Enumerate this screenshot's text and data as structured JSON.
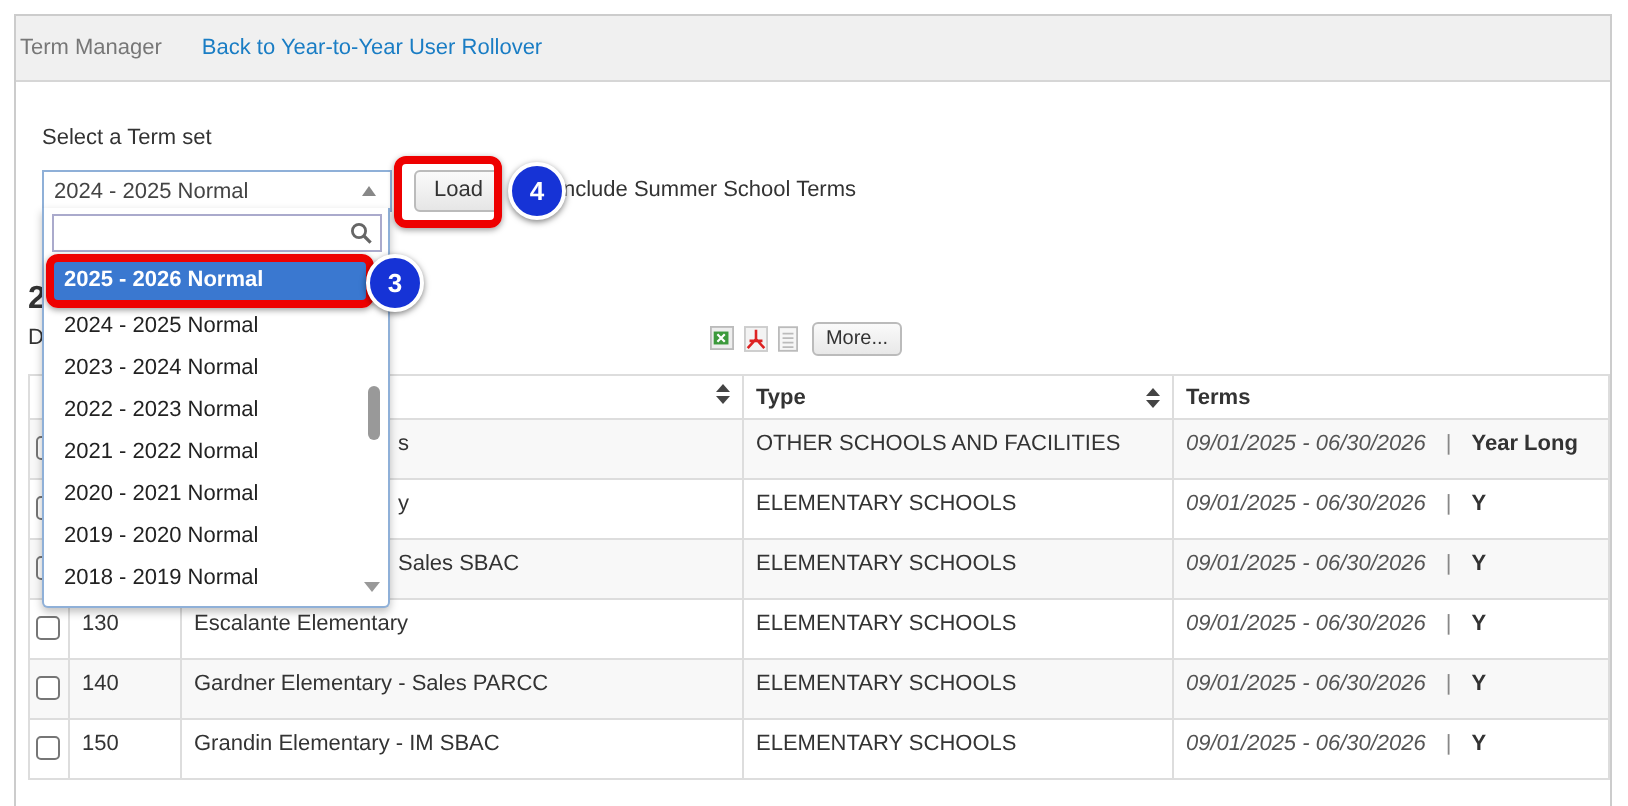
{
  "header": {
    "title": "Term Manager",
    "link": "Back to Year-to-Year User Rollover"
  },
  "term_set": {
    "label": "Select a Term set",
    "value": "2024 - 2025 Normal",
    "load_button": "Load",
    "summer_label": "nclude Summer School Terms"
  },
  "dropdown": {
    "options": [
      {
        "label": "2025 - 2026 Normal",
        "selected": true
      },
      {
        "label": "2024 - 2025 Normal",
        "selected": false
      },
      {
        "label": "2023 - 2024 Normal",
        "selected": false
      },
      {
        "label": "2022 - 2023 Normal",
        "selected": false
      },
      {
        "label": "2021 - 2022 Normal",
        "selected": false
      },
      {
        "label": "2020 - 2021 Normal",
        "selected": false
      },
      {
        "label": "2019 - 2020 Normal",
        "selected": false
      },
      {
        "label": "2018 - 2019 Normal",
        "selected": false
      }
    ]
  },
  "load_callout": "4",
  "option_callout": "3",
  "heading": "2",
  "subtitle": "D",
  "more_button": "More...",
  "table": {
    "columns": [
      "Type",
      "Terms"
    ],
    "rows": [
      {
        "checked": false,
        "covered": true,
        "number": "",
        "name": "s",
        "type": "OTHER SCHOOLS AND FACILITIES",
        "dates": "09/01/2025 - 06/30/2026",
        "separator": "|",
        "term": "Year Long"
      },
      {
        "checked": false,
        "covered": true,
        "number": "",
        "name": "y",
        "type": "ELEMENTARY SCHOOLS",
        "dates": "09/01/2025 - 06/30/2026",
        "separator": "|",
        "term": "Y"
      },
      {
        "checked": false,
        "covered": true,
        "number": "",
        "name": "Sales SBAC",
        "type": "ELEMENTARY SCHOOLS",
        "dates": "09/01/2025 - 06/30/2026",
        "separator": "|",
        "term": "Y"
      },
      {
        "checked": false,
        "covered": false,
        "number": "130",
        "name": "Escalante Elementary",
        "type": "ELEMENTARY SCHOOLS",
        "dates": "09/01/2025 - 06/30/2026",
        "separator": "|",
        "term": "Y"
      },
      {
        "checked": false,
        "covered": false,
        "number": "140",
        "name": "Gardner Elementary - Sales PARCC",
        "type": "ELEMENTARY SCHOOLS",
        "dates": "09/01/2025 - 06/30/2026",
        "separator": "|",
        "term": "Y"
      },
      {
        "checked": false,
        "covered": false,
        "number": "150",
        "name": "Grandin Elementary - IM SBAC",
        "type": "ELEMENTARY SCHOOLS",
        "dates": "09/01/2025 - 06/30/2026",
        "separator": "|",
        "term": "Y"
      }
    ]
  }
}
